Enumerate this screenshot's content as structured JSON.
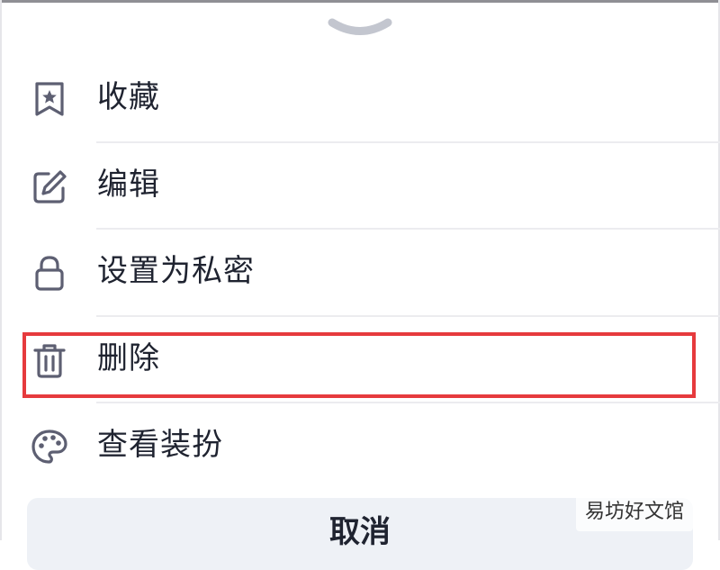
{
  "sheet": {
    "handle_icon": "chevron-down-icon",
    "items": [
      {
        "label": "收藏",
        "icon": "bookmark-star-icon"
      },
      {
        "label": "编辑",
        "icon": "edit-icon"
      },
      {
        "label": "设置为私密",
        "icon": "lock-icon"
      },
      {
        "label": "删除",
        "icon": "trash-icon",
        "highlighted": true
      },
      {
        "label": "查看装扮",
        "icon": "palette-icon"
      }
    ],
    "cancel_label": "取消"
  },
  "annotation": {
    "highlight_color": "#e63a3d",
    "target": "删除"
  },
  "watermark": "易坊好文馆",
  "colors": {
    "icon": "#5d5f72",
    "text": "#1f2330",
    "divider": "#ececef",
    "cancel_bg": "#eef1f6"
  }
}
